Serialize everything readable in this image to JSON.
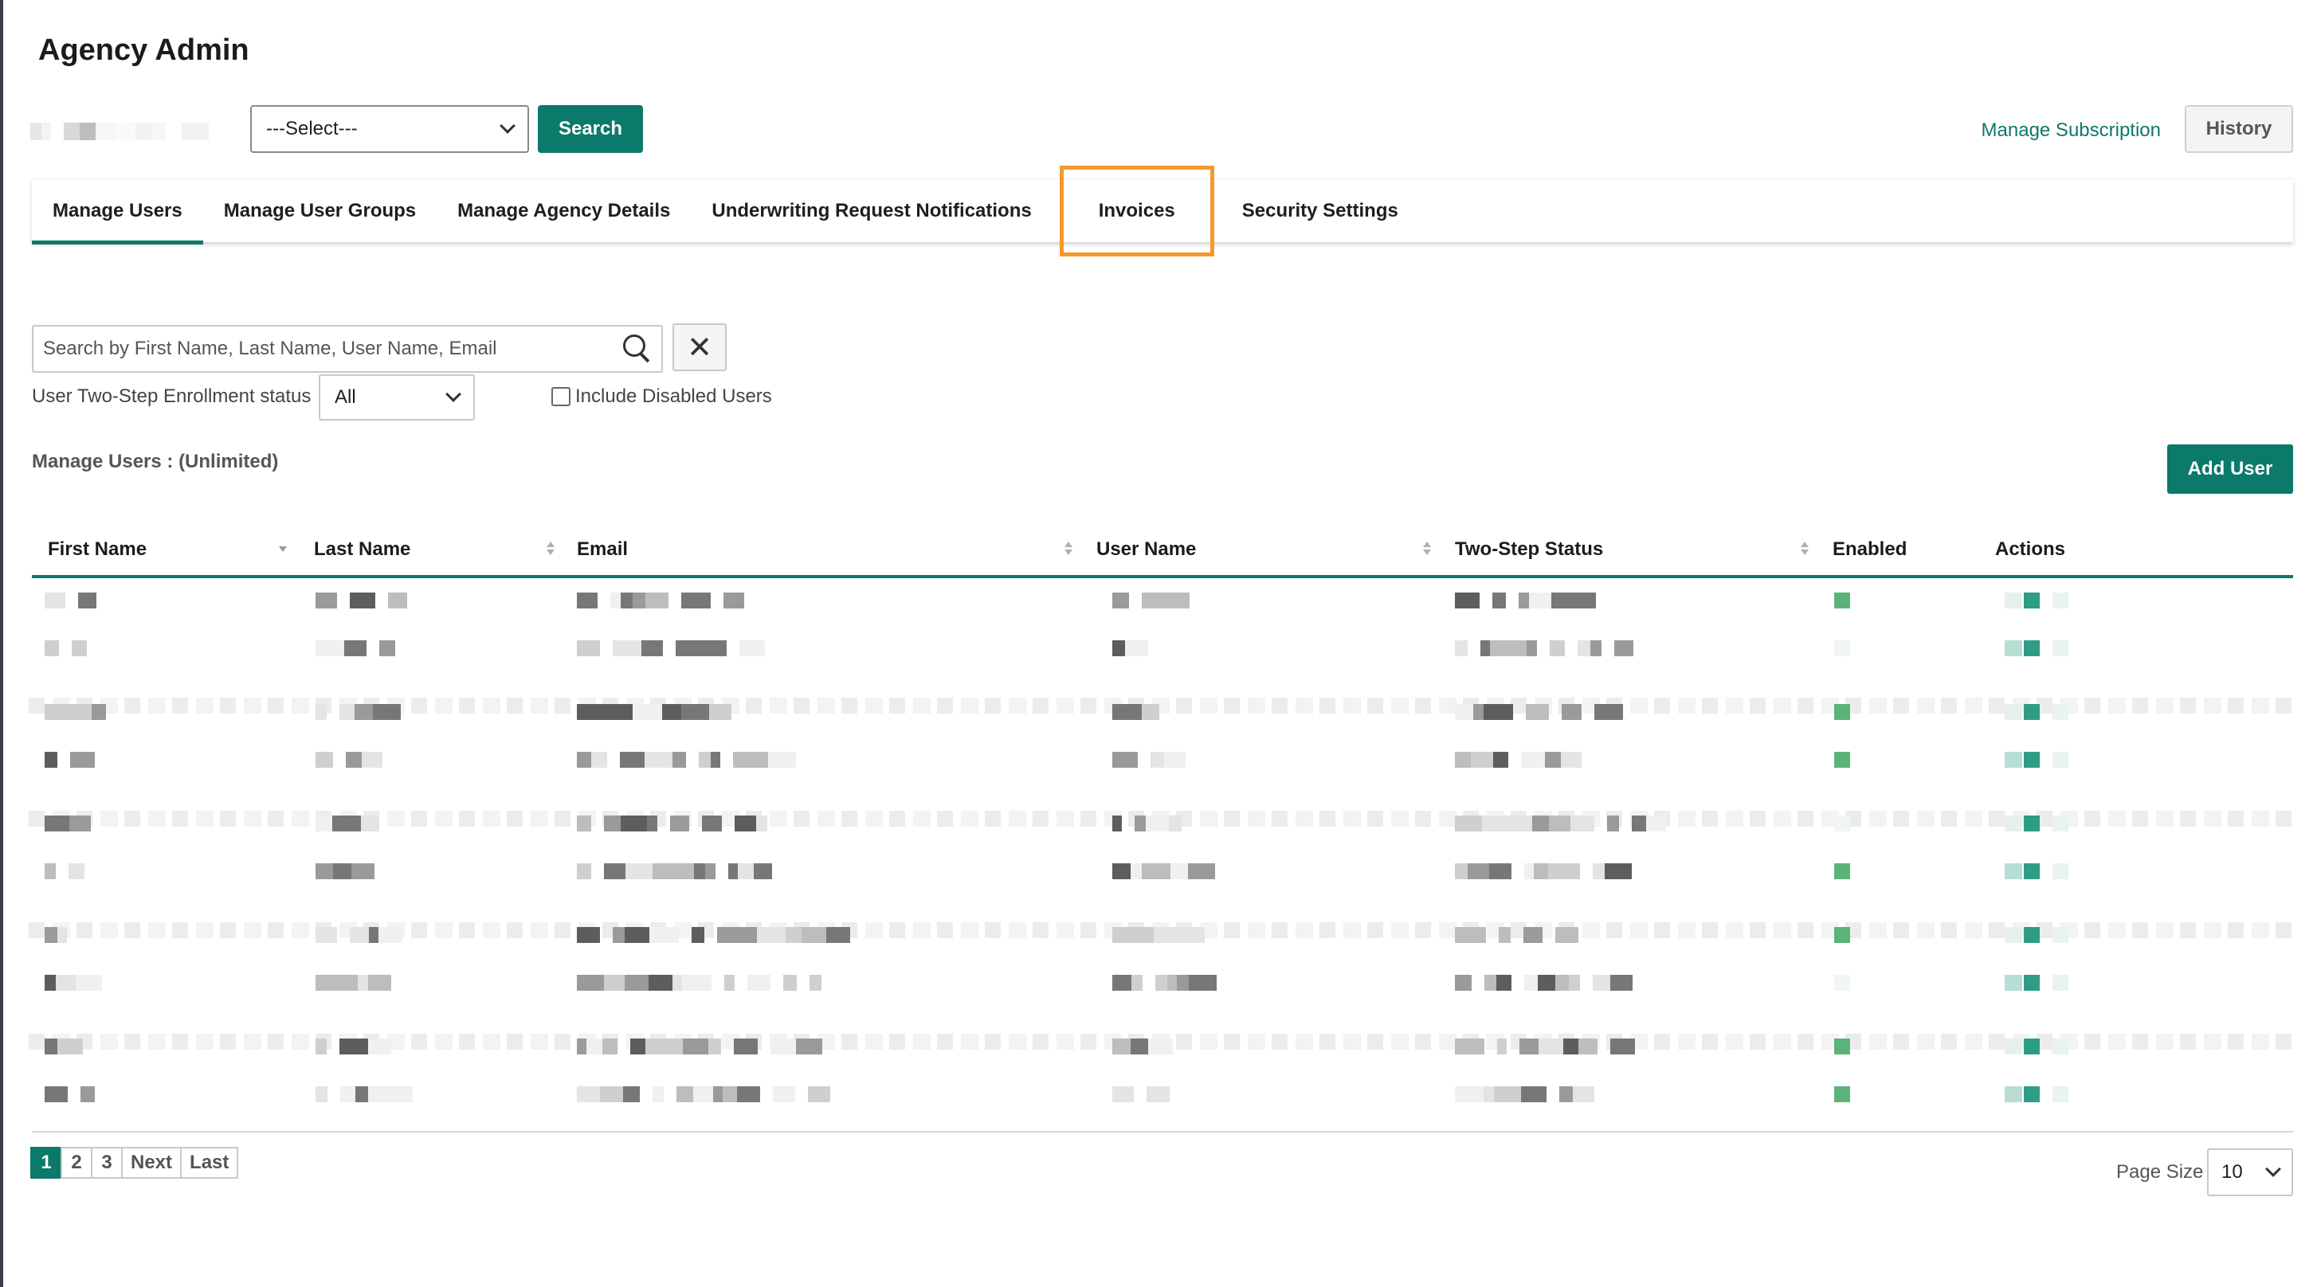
{
  "page": {
    "title": "Agency Admin"
  },
  "toolbar": {
    "agency_select_value": "---Select---",
    "search_label": "Search",
    "manage_subscription_label": "Manage Subscription",
    "history_label": "History"
  },
  "tabs": [
    {
      "label": "Manage Users",
      "active": true
    },
    {
      "label": "Manage User Groups"
    },
    {
      "label": "Manage Agency Details"
    },
    {
      "label": "Underwriting Request Notifications"
    },
    {
      "label": "Invoices",
      "highlighted": true
    },
    {
      "label": "Security Settings"
    }
  ],
  "filters": {
    "search_placeholder": "Search by First Name, Last Name, User Name, Email",
    "clear_glyph": "✕",
    "enrollment_label": "User Two-Step Enrollment status",
    "enrollment_value": "All",
    "include_disabled_label": "Include Disabled Users",
    "include_disabled_checked": false
  },
  "users": {
    "count_label": "Manage Users : (Unlimited)",
    "add_user_label": "Add User",
    "columns": [
      "First Name",
      "Last Name",
      "Email",
      "User Name",
      "Two-Step Status",
      "Enabled",
      "Actions"
    ],
    "row_count": 10,
    "rows_note": ""
  },
  "pagination": {
    "pages": [
      "1",
      "2",
      "3"
    ],
    "current": "1",
    "next_label": "Next",
    "last_label": "Last",
    "page_size_label": "Page Size",
    "page_size_value": "10"
  },
  "colors": {
    "brand_green": "#0b7a6a",
    "highlight_orange": "#f5992c"
  },
  "icons": {
    "search": "magnifier-icon",
    "clear": "close-icon",
    "dropdown": "chevron-down-icon"
  }
}
